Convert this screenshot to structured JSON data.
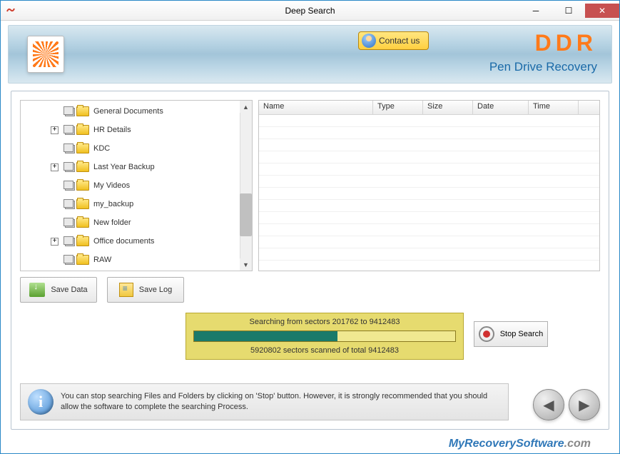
{
  "window": {
    "title": "Deep Search"
  },
  "header": {
    "contact_label": "Contact us",
    "brand": "DDR",
    "brand_sub": "Pen Drive Recovery"
  },
  "tree": {
    "items": [
      {
        "label": "General Documents",
        "expandable": false
      },
      {
        "label": "HR Details",
        "expandable": true
      },
      {
        "label": "KDC",
        "expandable": false
      },
      {
        "label": "Last Year Backup",
        "expandable": true
      },
      {
        "label": "My Videos",
        "expandable": false
      },
      {
        "label": "my_backup",
        "expandable": false
      },
      {
        "label": "New folder",
        "expandable": false
      },
      {
        "label": "Office documents",
        "expandable": true
      },
      {
        "label": "RAW",
        "expandable": false
      }
    ]
  },
  "list": {
    "columns": {
      "name": "Name",
      "type": "Type",
      "size": "Size",
      "date": "Date",
      "time": "Time"
    }
  },
  "actions": {
    "save_data": "Save Data",
    "save_log": "Save Log"
  },
  "progress": {
    "line1": "Searching from sectors  201762 to 9412483",
    "line2": "5920802  sectors scanned of total  9412483",
    "percent": 55
  },
  "stop": {
    "label": "Stop Search"
  },
  "info": {
    "text": "You can stop searching Files and Folders by clicking on 'Stop' button. However, it is strongly recommended that you should allow the software to complete the searching Process."
  },
  "watermark": {
    "part1": "MyRecoverySoftware",
    "part2": ".com"
  }
}
